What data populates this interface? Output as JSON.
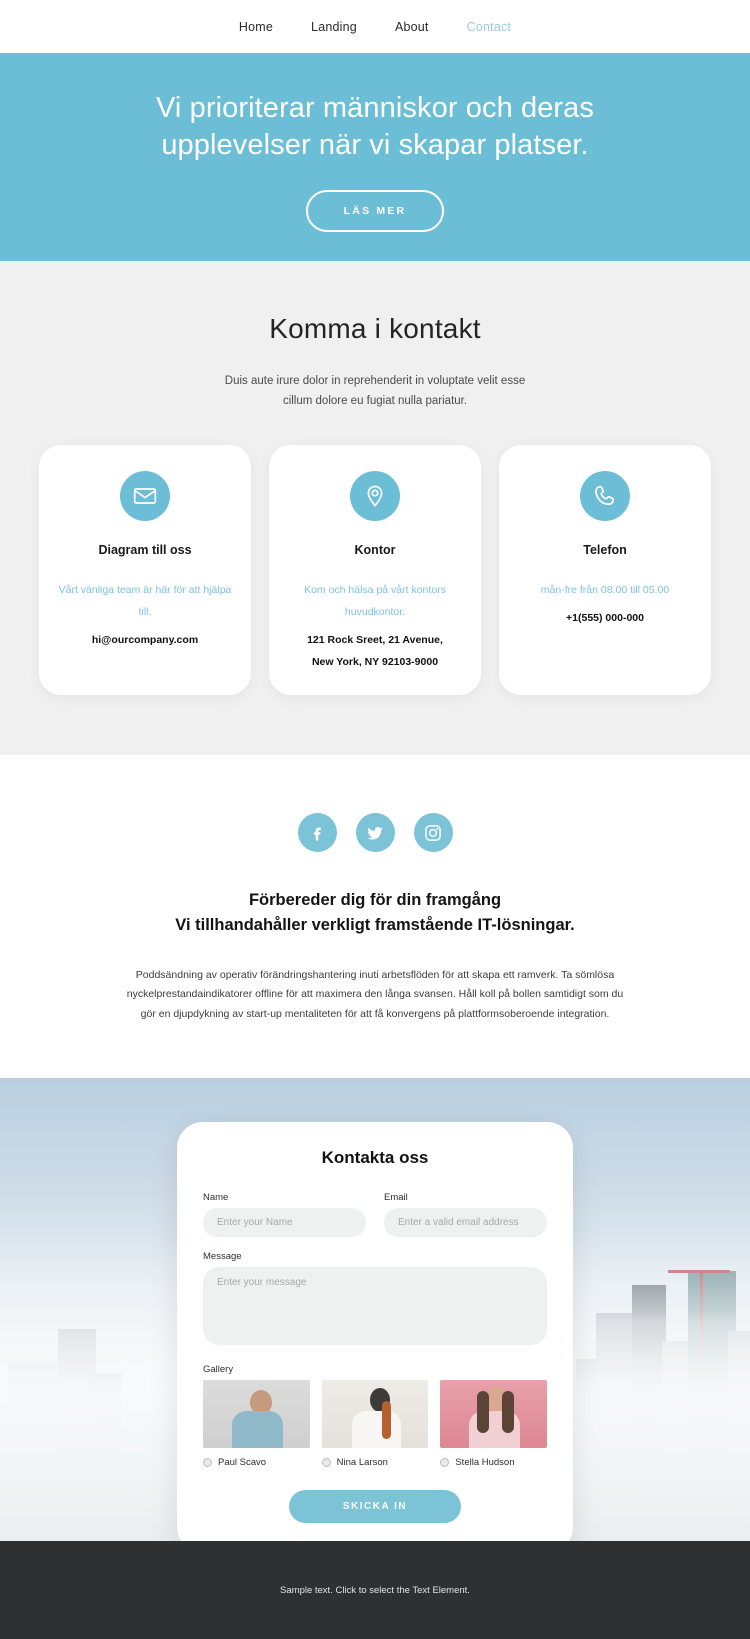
{
  "nav": {
    "items": [
      {
        "label": "Home",
        "active": false
      },
      {
        "label": "Landing",
        "active": false
      },
      {
        "label": "About",
        "active": false
      },
      {
        "label": "Contact",
        "active": true
      }
    ]
  },
  "hero": {
    "title": "Vi prioriterar människor och deras upplevelser när vi skapar platser.",
    "button_label": "LÄS MER",
    "background_color": "#6cbed6"
  },
  "contact_section": {
    "title": "Komma i kontakt",
    "subtitle": "Duis aute irure dolor in reprehenderit in voluptate velit esse cillum dolore eu fugiat nulla pariatur.",
    "background_color": "#f0f0f0",
    "cards": [
      {
        "icon": "envelope-icon",
        "title": "Diagram till oss",
        "description": "Vårt vänliga team är här för att hjälpa till.",
        "value": "hi@ourcompany.com",
        "value2": ""
      },
      {
        "icon": "map-pin-icon",
        "title": "Kontor",
        "description": "Kom och hälsa på vårt kontors huvudkontor.",
        "value": "121 Rock Sreet, 21 Avenue,",
        "value2": "New York, NY 92103-9000"
      },
      {
        "icon": "phone-icon",
        "title": "Telefon",
        "description": "mån-fre från 08.00 till 05.00",
        "value": "+1(555) 000-000",
        "value2": ""
      }
    ]
  },
  "info_section": {
    "socials": [
      {
        "name": "facebook-icon"
      },
      {
        "name": "twitter-icon"
      },
      {
        "name": "instagram-icon"
      }
    ],
    "heading_line1": "Förbereder dig för din framgång",
    "heading_line2": "Vi tillhandahåller verkligt framstående IT-lösningar.",
    "paragraph": "Poddsändning av operativ förändringshantering inuti arbetsflöden för att skapa ett ramverk. Ta sömlösa nyckelprestandaindikatorer offline för att maximera den långa svansen. Håll koll på bollen samtidigt som du gör en djupdykning av start-up mentaliteten för att få konvergens på plattformsoberoende integration."
  },
  "form": {
    "title": "Kontakta oss",
    "name_label": "Name",
    "name_placeholder": "Enter your Name",
    "name_value": "",
    "email_label": "Email",
    "email_placeholder": "Enter a valid email address",
    "email_value": "",
    "message_label": "Message",
    "message_placeholder": "Enter your message",
    "message_value": "",
    "gallery_label": "Gallery",
    "gallery": [
      {
        "name": "Paul Scavo",
        "selected": false
      },
      {
        "name": "Nina Larson",
        "selected": false
      },
      {
        "name": "Stella Hudson",
        "selected": false
      }
    ],
    "submit_label": "SKICKA IN",
    "accent_color": "#7cc3d8"
  },
  "footer": {
    "text": "Sample text. Click to select the Text Element.",
    "background_color": "#2f3031"
  }
}
